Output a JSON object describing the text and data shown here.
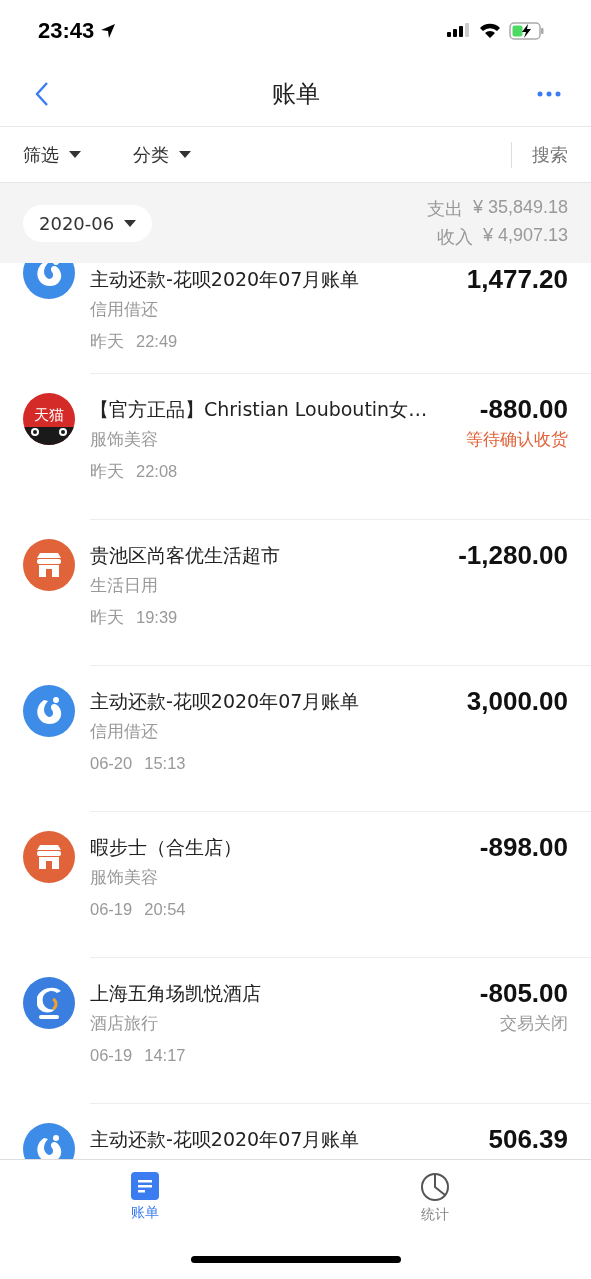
{
  "status_bar": {
    "time": "23:43"
  },
  "nav": {
    "title": "账单"
  },
  "filters": [
    {
      "label": "筛选"
    },
    {
      "label": "分类"
    }
  ],
  "search": {
    "label": "搜索"
  },
  "summary": {
    "month": "2020-06",
    "expense_label": "支出",
    "expense": "¥ 35,849.18",
    "income_label": "收入",
    "income": "¥ 4,907.13"
  },
  "transactions": [
    {
      "kind": "huabei",
      "title": "主动还款-花呗2020年07月账单",
      "category": "信用借还",
      "date": "昨天",
      "time": "22:49",
      "amount": "1,477.20"
    },
    {
      "kind": "tmall",
      "icon_text": "天猫",
      "title": "【官方正品】Christian Louboutin女…",
      "category": "服饰美容",
      "date": "昨天",
      "time": "22:08",
      "amount": "-880.00",
      "status": {
        "text": "等待确认收货",
        "kind": "pending"
      }
    },
    {
      "kind": "store",
      "title": "贵池区尚客优生活超市",
      "category": "生活日用",
      "date": "昨天",
      "time": "19:39",
      "amount": "-1,280.00"
    },
    {
      "kind": "huabei",
      "title": "主动还款-花呗2020年07月账单",
      "category": "信用借还",
      "date": "06-20",
      "time": "15:13",
      "amount": "3,000.00"
    },
    {
      "kind": "store",
      "title": "暇步士（合生店）",
      "category": "服饰美容",
      "date": "06-19",
      "time": "20:54",
      "amount": "-898.00"
    },
    {
      "kind": "ctrip",
      "title": "上海五角场凯悦酒店",
      "category": "酒店旅行",
      "date": "06-19",
      "time": "14:17",
      "amount": "-805.00",
      "status": {
        "text": "交易关闭",
        "kind": "closed"
      }
    },
    {
      "kind": "huabei",
      "title": "主动还款-花呗2020年07月账单",
      "amount": "506.39"
    }
  ],
  "tabs": [
    {
      "kind": "bill",
      "label": "账单",
      "selected": true
    },
    {
      "kind": "stats",
      "label": "统计",
      "selected": false
    }
  ]
}
